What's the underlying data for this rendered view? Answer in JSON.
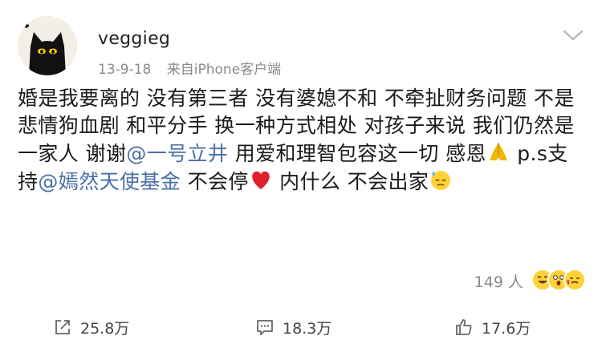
{
  "post": {
    "username": "veggieg",
    "date": "13-9-18",
    "source": "来自iPhone客户端",
    "text_1": "婚是我要离的 没有第三者 没有婆媳不和 不牵扯财务问题 不是悲情狗血剧 和平分手 换一种方式相处 对孩子来说 我们仍然是一家人 谢谢",
    "mention_1": "@一号立井",
    "text_2": " 用爱和理智包容这一切 感恩",
    "text_3": " p.s支持",
    "mention_2": "@嫣然天使基金",
    "text_4": " 不会停",
    "text_5": " 内什么 不会出家"
  },
  "likes": {
    "count": "149",
    "unit": "人"
  },
  "actions": {
    "repost": "25.8万",
    "comment": "18.3万",
    "like": "17.6万"
  },
  "icons": {
    "repost": "share-icon",
    "comment": "comment-icon",
    "like": "thumbs-up-icon",
    "more": "chevron-down-icon",
    "pray": "folded-hands-emoji",
    "heart": "red-heart-emoji",
    "sweat": "sweat-face-emoji"
  },
  "colors": {
    "mention": "#4a6fa5",
    "meta_text": "#8a8a8a",
    "heart": "#e0202a"
  }
}
